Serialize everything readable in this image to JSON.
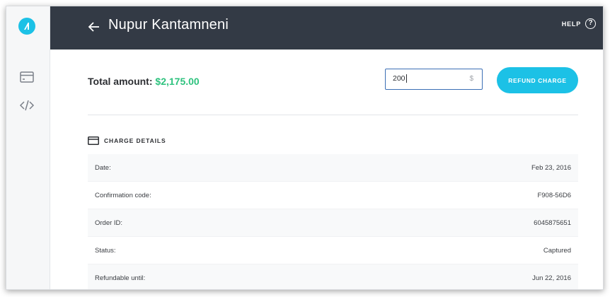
{
  "header": {
    "title": "Nupur Kantamneni",
    "help_label": "HELP",
    "help_icon_glyph": "?"
  },
  "sidebar": {
    "items": [
      {
        "name": "logo",
        "icon": "brand-logo-icon"
      },
      {
        "name": "charges",
        "icon": "credit-card-icon"
      },
      {
        "name": "developer",
        "icon": "code-icon"
      }
    ]
  },
  "summary": {
    "total_label": "Total amount:",
    "total_value": "$2,175.00"
  },
  "refund": {
    "input_value": "200",
    "currency_symbol": "$",
    "button_label": "REFUND CHARGE"
  },
  "details": {
    "section_title": "CHARGE DETAILS",
    "rows": [
      {
        "label": "Date:",
        "value": "Feb 23, 2016"
      },
      {
        "label": "Confirmation code:",
        "value": "F908-56D6"
      },
      {
        "label": "Order ID:",
        "value": "6045875651"
      },
      {
        "label": "Status:",
        "value": "Captured"
      },
      {
        "label": "Refundable until:",
        "value": "Jun 22, 2016"
      }
    ]
  },
  "colors": {
    "accent": "#1cc1e6",
    "header_bg": "#333a45",
    "amount_green": "#2ec27e",
    "input_border": "#3b6fb5"
  }
}
